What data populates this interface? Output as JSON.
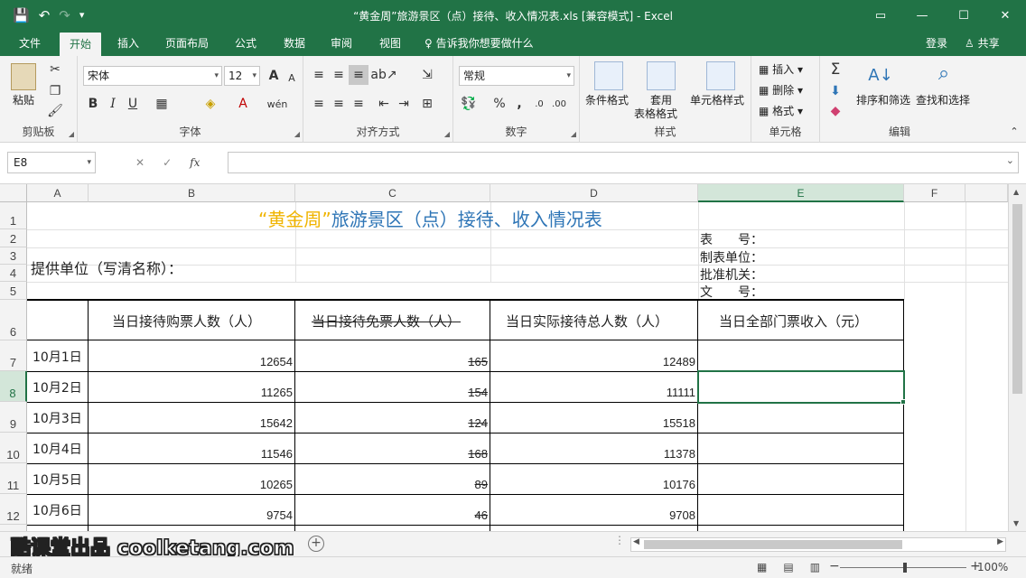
{
  "window": {
    "title": "“黄金周”旅游景区（点）接待、收入情况表.xls  [兼容模式] - Excel",
    "save_icon": "💾",
    "undo_icon": "↶",
    "redo_icon": "↷",
    "qat_more": "▾",
    "ribbon_display": "▭",
    "minimize": "—",
    "maximize": "☐",
    "close": "✕"
  },
  "tabs": [
    "文件",
    "开始",
    "插入",
    "页面布局",
    "公式",
    "数据",
    "审阅",
    "视图"
  ],
  "active_tab": "开始",
  "tell_me": "♀ 告诉我你想要做什么",
  "login": "登录",
  "share": "♙ 共享",
  "ribbon": {
    "clipboard": {
      "label": "剪贴板",
      "paste": "粘贴"
    },
    "font": {
      "label": "字体",
      "name": "宋体",
      "size": "12",
      "bold": "B",
      "italic": "I",
      "underline": "U",
      "grow": "A",
      "shrink": "A"
    },
    "alignment": {
      "label": "对齐方式"
    },
    "number": {
      "label": "数字",
      "format": "常规",
      "percent": "%",
      "comma": ","
    },
    "styles": {
      "label": "样式",
      "conditional": "条件格式",
      "table1": "套用",
      "table2": "表格格式",
      "cell_styles": "单元格样式"
    },
    "cells": {
      "label": "单元格",
      "insert": "插入",
      "delete": "删除",
      "format": "格式"
    },
    "editing": {
      "label": "编辑",
      "sort": "排序和筛选",
      "find": "查找和选择"
    }
  },
  "formula_bar": {
    "name_box": "E8",
    "cancel": "✕",
    "enter": "✓",
    "fx": "fx"
  },
  "columns": [
    "A",
    "B",
    "C",
    "D",
    "E",
    "F"
  ],
  "selected_col": "E",
  "rows": [
    "1",
    "2",
    "3",
    "4",
    "5",
    "6",
    "7",
    "8",
    "9",
    "10",
    "11",
    "12"
  ],
  "selected_row": "8",
  "sheet": {
    "title_quote": "“黄金周”",
    "title_rest": "旅游景区（点）接待、收入情况表",
    "provider": "提供单位（写清名称）：",
    "meta": [
      "表　　号：",
      "制表单位：",
      "批准机关：",
      "文　　号："
    ],
    "headers": [
      "当日接待购票人数（人）",
      "当日接待免票人数（人）",
      "当日实际接待总人数（人）",
      "当日全部门票收入（元）"
    ],
    "data": [
      {
        "date": "10月1日",
        "paid": "12654",
        "free": "165",
        "total": "12489"
      },
      {
        "date": "10月2日",
        "paid": "11265",
        "free": "154",
        "total": "11111"
      },
      {
        "date": "10月3日",
        "paid": "15642",
        "free": "124",
        "total": "15518"
      },
      {
        "date": "10月4日",
        "paid": "11546",
        "free": "168",
        "total": "11378"
      },
      {
        "date": "10月5日",
        "paid": "10265",
        "free": "89",
        "total": "10176"
      },
      {
        "date": "10月6日",
        "paid": "9754",
        "free": "46",
        "total": "9708"
      }
    ]
  },
  "watermark": "酷课堂出品 coolketang.com",
  "status": {
    "ready": "就绪",
    "zoom": "100%",
    "minus": "−",
    "plus": "+"
  }
}
